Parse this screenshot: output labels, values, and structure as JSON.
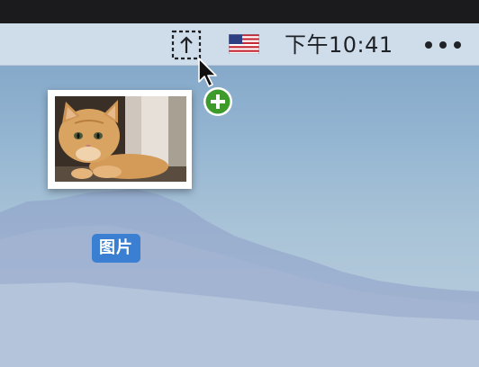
{
  "menubar": {
    "upload_icon": "upload-arrow-icon",
    "input_source_icon": "us-flag-icon",
    "clock": "下午10:41",
    "more_icon": "ellipsis-icon"
  },
  "drag": {
    "thumbnail_icon": "cat-photo-thumbnail",
    "badge_icon": "plus-badge-icon",
    "cursor_icon": "arrow-cursor-icon"
  },
  "desktop": {
    "file_label": "图片"
  },
  "colors": {
    "menubar_bg": "#d6e2ee",
    "label_bg": "#3b7fd3",
    "plus_badge": "#3e9a2a"
  }
}
